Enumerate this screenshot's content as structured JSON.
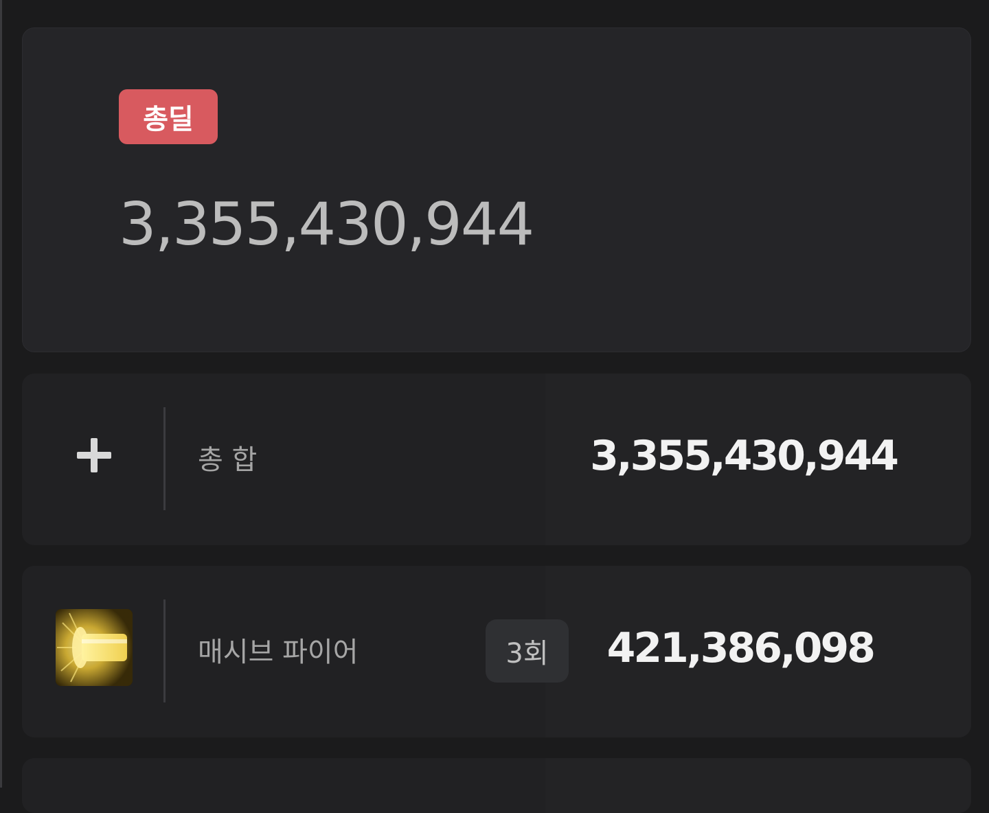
{
  "summary": {
    "badge_label": "총딜",
    "total_value": "3,355,430,944"
  },
  "rows": [
    {
      "icon": "plus-icon",
      "label": "총 합",
      "value": "3,355,430,944"
    },
    {
      "icon": "massive-fire-skill-icon",
      "label": "매시브 파이어",
      "count": "3회",
      "value": "421,386,098"
    }
  ],
  "colors": {
    "badge": "#d85a5f",
    "card": "#252528",
    "row_card": "#212123",
    "background": "#1b1b1c"
  }
}
